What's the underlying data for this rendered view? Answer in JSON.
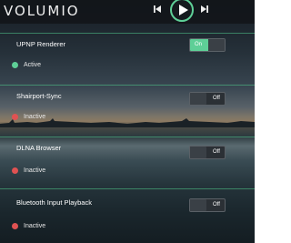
{
  "app": {
    "logo": "VOLUMIO"
  },
  "player": {
    "prev_icon": "skip-previous-icon",
    "play_icon": "play-icon",
    "next_icon": "skip-next-icon",
    "accent": "#5ecf97"
  },
  "plugins": [
    {
      "name": "UPNP Renderer",
      "status": "Active",
      "status_color": "#5ecf97",
      "toggle": "On",
      "enabled": true
    },
    {
      "name": "Shairport-Sync",
      "status": "Inactive",
      "status_color": "#e05252",
      "toggle": "Off",
      "enabled": false
    },
    {
      "name": "DLNA Browser",
      "status": "Inactive",
      "status_color": "#e05252",
      "toggle": "Off",
      "enabled": false
    },
    {
      "name": "Bluetooth Input Playback",
      "status": "Inactive",
      "status_color": "#e05252",
      "toggle": "Off",
      "enabled": false
    }
  ]
}
